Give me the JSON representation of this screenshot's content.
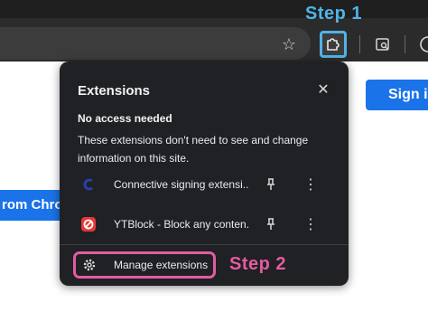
{
  "annotations": {
    "step1": "Step 1",
    "step2": "Step 2"
  },
  "page": {
    "signin_label": "Sign in",
    "from_chrome_label": "rom Chrom"
  },
  "popup": {
    "title": "Extensions",
    "close_icon": "close-icon",
    "access_heading": "No access needed",
    "access_description": "These extensions don't need to see and change information on this site.",
    "extensions": [
      {
        "name": "Connective signing extensi...",
        "icon": "connective-logo-icon"
      },
      {
        "name": "YTBlock - Block any conten...",
        "icon": "ytblock-logo-icon"
      }
    ],
    "manage_label": "Manage extensions"
  },
  "colors": {
    "annotation_step1": "#4fb3e8",
    "annotation_step2": "#e25ca0",
    "primary_button": "#1a73e8",
    "popup_bg": "#202124"
  }
}
